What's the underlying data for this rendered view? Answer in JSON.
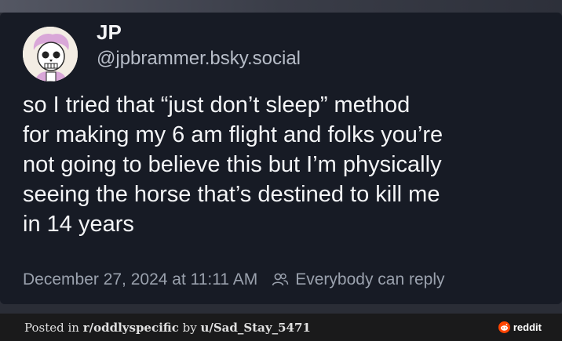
{
  "post": {
    "display_name": "JP",
    "handle": "@jpbrammer.bsky.social",
    "text": "so I tried that “just don’t sleep” method\nfor making my 6 am flight and folks you’re\nnot going to believe this but I’m physically\nseeing the horse that’s destined to kill me\nin 14 years",
    "timestamp": "December 27, 2024 at 11:11 AM",
    "reply_setting": "Everybody can reply"
  },
  "footer": {
    "prefix": "Posted in ",
    "subreddit": "r/oddlyspecific",
    "by": " by ",
    "user": "u/Sad_Stay_5471",
    "brand": "reddit"
  },
  "colors": {
    "card_bg": "#171b25",
    "footer_bg": "#1a1a1b",
    "reddit_orange": "#ff4500"
  },
  "icons": {
    "avatar": "skeleton-cartoon-avatar",
    "reply": "people-icon",
    "brand": "reddit-logo-icon"
  }
}
